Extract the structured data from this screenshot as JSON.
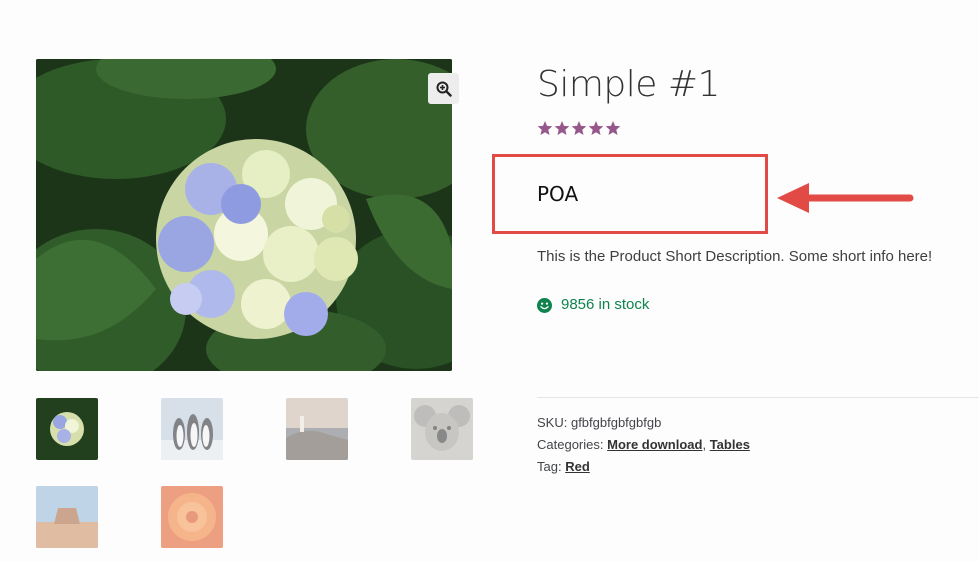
{
  "product": {
    "title": "Simple #1",
    "rating_stars": 5,
    "price": "POA",
    "short_description": "This is the Product Short Description. Some short info here!",
    "stock_text": "9856 in stock"
  },
  "meta": {
    "sku_label": "SKU:",
    "sku_value": "gfbfgbfgbfgbfgb",
    "categories_label": "Categories:",
    "categories": [
      "More download",
      "Tables"
    ],
    "separator": ",",
    "tag_label": "Tag:",
    "tag": "Red"
  },
  "gallery": {
    "main_image": "hydrangea-flower",
    "thumbnails": [
      "hydrangea-flower",
      "penguins",
      "lighthouse-coast",
      "koala",
      "desert-mesa",
      "orange-dahlia"
    ]
  },
  "colors": {
    "star": "#96588a",
    "stock": "#0f834d",
    "callout": "#e24a45"
  },
  "icons": {
    "zoom": "zoom-in-icon",
    "stock": "smiley-icon",
    "callout": "arrow-left-icon"
  }
}
